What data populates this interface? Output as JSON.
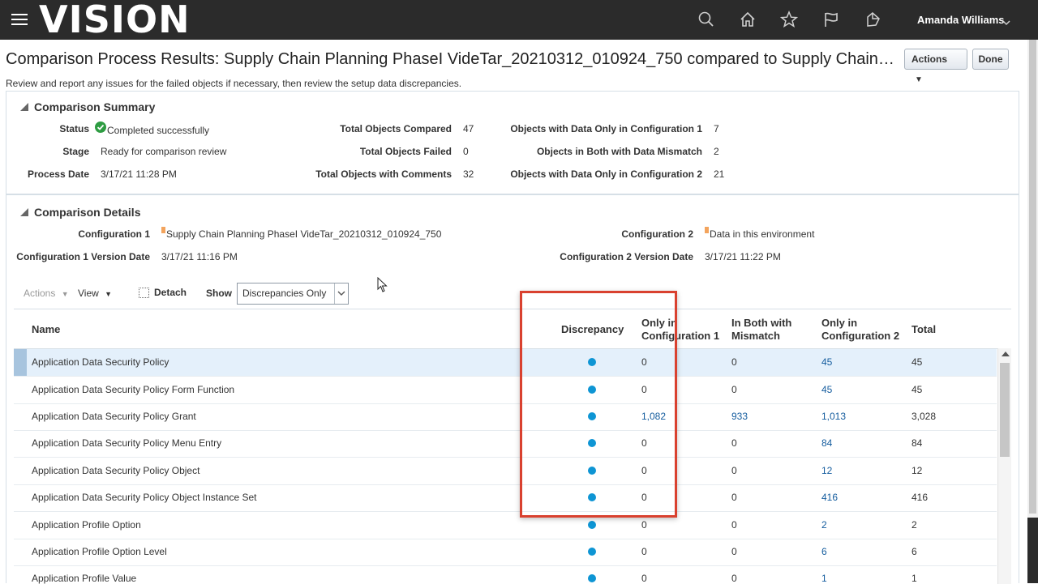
{
  "header": {
    "logo": "VISION",
    "user_name": "Amanda Williams",
    "icons": [
      "search-icon",
      "home-icon",
      "star-icon",
      "flag-icon",
      "notifications-icon"
    ]
  },
  "page": {
    "title": "Comparison Process Results: Supply Chain Planning PhaseI VideTar_20210312_010924_750 compared to Supply Chain Planning ...",
    "subtitle": "Review and report any issues for the failed objects if necessary, then review the setup data discrepancies.",
    "actions_label": "Actions",
    "done_label": "Done"
  },
  "summary": {
    "title": "Comparison Summary",
    "status_label": "Status",
    "status_value": "Completed successfully",
    "stage_label": "Stage",
    "stage_value": "Ready for comparison review",
    "process_date_label": "Process Date",
    "process_date_value": "3/17/21 11:28 PM",
    "total_compared_label": "Total Objects Compared",
    "total_compared_value": "47",
    "total_failed_label": "Total Objects Failed",
    "total_failed_value": "0",
    "total_comments_label": "Total Objects with Comments",
    "total_comments_value": "32",
    "only_c1_label": "Objects with Data Only in Configuration 1",
    "only_c1_value": "7",
    "both_mismatch_label": "Objects in Both with Data Mismatch",
    "both_mismatch_value": "2",
    "only_c2_label": "Objects with Data Only in Configuration 2",
    "only_c2_value": "21"
  },
  "details": {
    "title": "Comparison Details",
    "config1_label": "Configuration 1",
    "config1_value": "Supply Chain Planning PhaseI VideTar_20210312_010924_750",
    "config1_version_label": "Configuration 1 Version Date",
    "config1_version_value": "3/17/21 11:16 PM",
    "config2_label": "Configuration 2",
    "config2_value": "Data in this environment",
    "config2_version_label": "Configuration 2 Version Date",
    "config2_version_value": "3/17/21 11:22 PM"
  },
  "toolbar": {
    "actions": "Actions",
    "view": "View",
    "detach": "Detach",
    "show_label": "Show",
    "show_value": "Discrepancies Only"
  },
  "table": {
    "columns": {
      "name": "Name",
      "discrepancy": "Discrepancy",
      "only_c1_line1": "Only in",
      "only_c1_line2": "Configuration 1",
      "both_line1": "In Both with",
      "both_line2": "Mismatch",
      "only_c2_line1": "Only in",
      "only_c2_line2": "Configuration 2",
      "total": "Total"
    },
    "rows": [
      {
        "name": "Application Data Security Policy",
        "only_c1": "0",
        "both": "0",
        "only_c2": "45",
        "total": "45"
      },
      {
        "name": "Application Data Security Policy Form Function",
        "only_c1": "0",
        "both": "0",
        "only_c2": "45",
        "total": "45"
      },
      {
        "name": "Application Data Security Policy Grant",
        "only_c1": "1,082",
        "both": "933",
        "only_c2": "1,013",
        "total": "3,028"
      },
      {
        "name": "Application Data Security Policy Menu Entry",
        "only_c1": "0",
        "both": "0",
        "only_c2": "84",
        "total": "84"
      },
      {
        "name": "Application Data Security Policy Object",
        "only_c1": "0",
        "both": "0",
        "only_c2": "12",
        "total": "12"
      },
      {
        "name": "Application Data Security Policy Object Instance Set",
        "only_c1": "0",
        "both": "0",
        "only_c2": "416",
        "total": "416"
      },
      {
        "name": "Application Profile Option",
        "only_c1": "0",
        "both": "0",
        "only_c2": "2",
        "total": "2"
      },
      {
        "name": "Application Profile Option Level",
        "only_c1": "0",
        "both": "0",
        "only_c2": "6",
        "total": "6"
      },
      {
        "name": "Application Profile Value",
        "only_c1": "0",
        "both": "0",
        "only_c2": "1",
        "total": "1"
      }
    ]
  },
  "colors": {
    "header_bg": "#2b2b2b",
    "discrepancy_dot": "#0e95d4",
    "link": "#145c9e",
    "highlight_box": "#d9412f",
    "selected_row": "#e4f0fb"
  }
}
